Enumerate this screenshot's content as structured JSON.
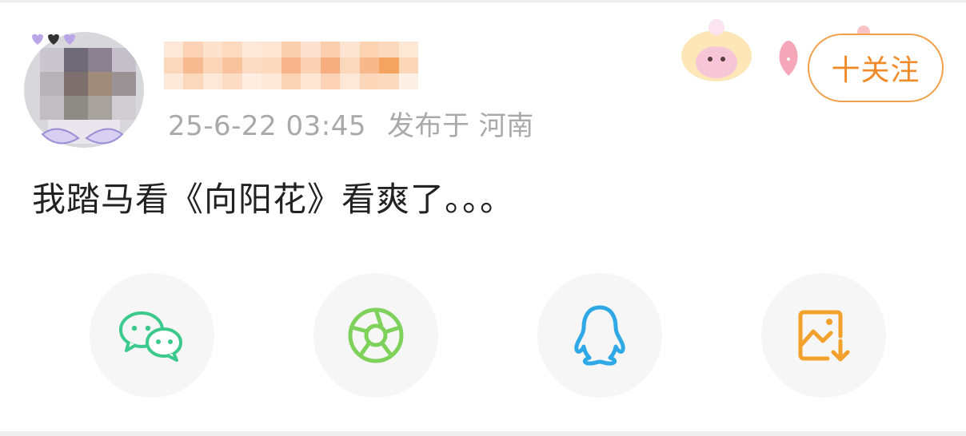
{
  "post": {
    "meta_time": "25-6-22 03:45",
    "meta_location": "发布于 河南",
    "text": "我踏马看《向阳花》看爽了。。。"
  },
  "follow": {
    "label": "十关注"
  },
  "share": {
    "items": [
      {
        "icon": "wechat-icon",
        "color": "#3cc98c"
      },
      {
        "icon": "moments-icon",
        "color": "#7ed15a"
      },
      {
        "icon": "qq-icon",
        "color": "#2fa8e6"
      },
      {
        "icon": "save-image-icon",
        "color": "#f2a12d"
      }
    ]
  },
  "colors": {
    "accent": "#f08a2a",
    "meta_text": "#a9a9a9",
    "body_text": "#222222",
    "button_bg": "#f6f6f6"
  }
}
